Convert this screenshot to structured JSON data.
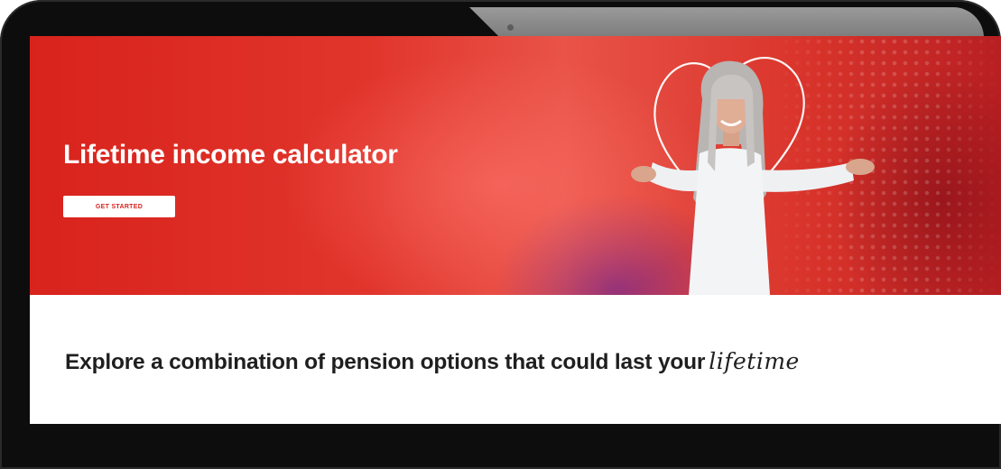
{
  "hero": {
    "title": "Lifetime income calculator",
    "cta_label": "GET STARTED",
    "colors": {
      "primary": "#d8231c",
      "button_bg": "#ffffff"
    },
    "image": "smiling-woman-open-arms-heart-outline"
  },
  "tagline": {
    "text": "Explore a combination of pension options that could last your",
    "script_word": "lifetime"
  }
}
